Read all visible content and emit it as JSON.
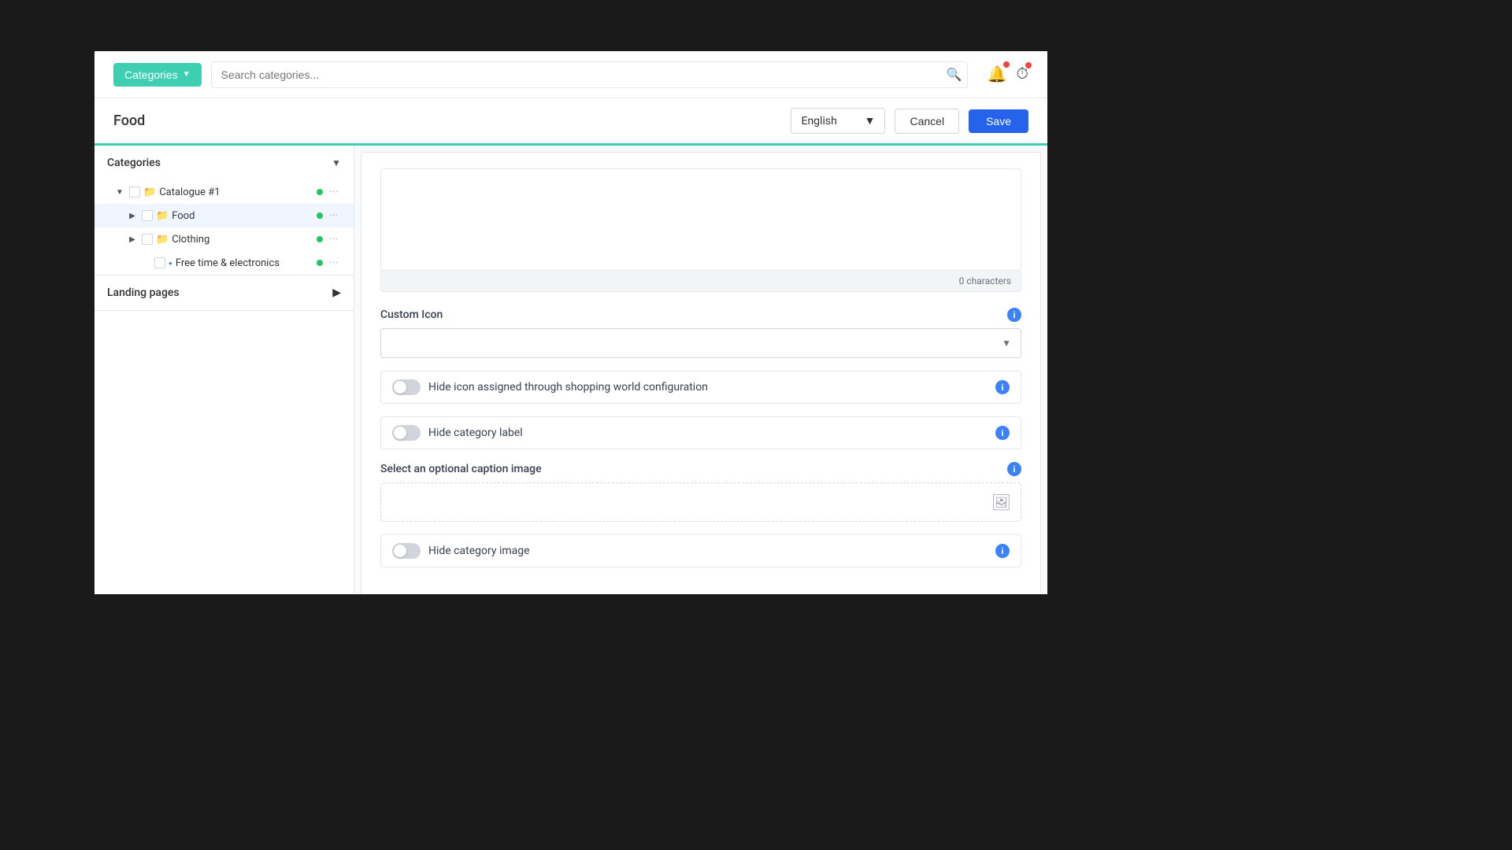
{
  "app": {
    "background": "#1a1a1a"
  },
  "topbar": {
    "categories_btn": "Categories",
    "search_placeholder": "Search categories...",
    "search_icon": "🔍"
  },
  "subheader": {
    "title": "Food",
    "language": "English",
    "cancel_btn": "Cancel",
    "save_btn": "Save"
  },
  "sidebar": {
    "categories_label": "Categories",
    "tree": [
      {
        "id": "catalogue1",
        "label": "Catalogue #1",
        "level": 1,
        "expanded": true,
        "has_toggle": true
      },
      {
        "id": "food",
        "label": "Food",
        "level": 2,
        "expanded": true,
        "has_toggle": true,
        "active": true
      },
      {
        "id": "clothing",
        "label": "Clothing",
        "level": 2,
        "expanded": false,
        "has_toggle": true
      },
      {
        "id": "free-time",
        "label": "Free time & electronics",
        "level": 3,
        "expanded": false,
        "has_toggle": false
      }
    ],
    "landing_pages_label": "Landing pages"
  },
  "panel": {
    "char_count": "0 characters",
    "custom_icon_label": "Custom Icon",
    "custom_icon_info": "i",
    "hide_icon_label": "Hide icon assigned through shopping world configuration",
    "hide_icon_info": "i",
    "hide_category_label_text": "Hide category label",
    "hide_category_label_info": "i",
    "caption_image_label": "Select an optional caption image",
    "caption_image_info": "i",
    "hide_category_image_label": "Hide category image",
    "hide_category_image_info": "i"
  }
}
